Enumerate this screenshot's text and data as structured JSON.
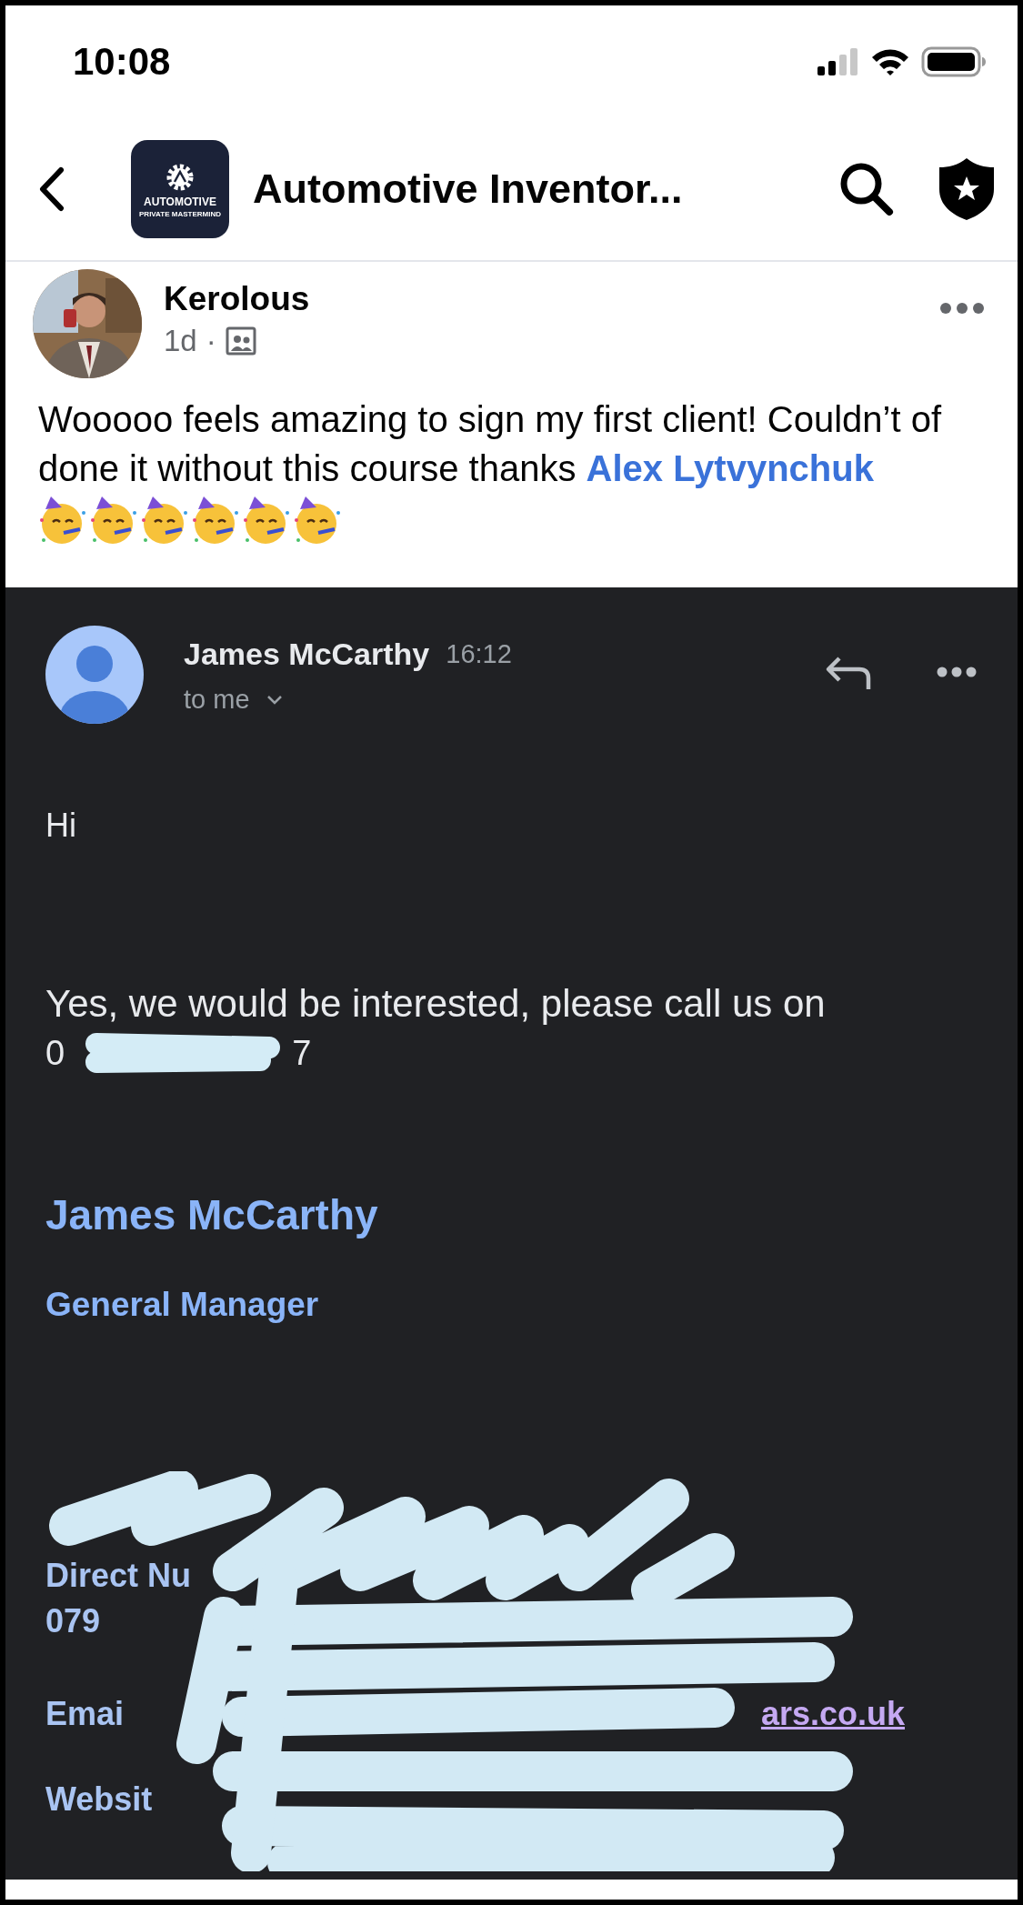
{
  "status_bar": {
    "time": "10:08"
  },
  "header": {
    "title": "Automotive Inventor...",
    "logo": {
      "title": "AUTOMOTIVE",
      "subtitle": "PRIVATE MASTERMIND"
    }
  },
  "post": {
    "author": "Kerolous",
    "age": "1d",
    "separator": "·",
    "text": "Wooooo feels amazing to sign my first client! Couldn’t of done it without this course thanks ",
    "mention": "Alex Lytvynchuk"
  },
  "email": {
    "sender": "James McCarthy",
    "time": "16:12",
    "recipient": "to me",
    "greeting": "Hi",
    "body": "Yes, we would be interested, please call us on",
    "phone_fragments": [
      "0",
      "7"
    ],
    "signature_name": "James McCarthy",
    "signature_title": "General Manager",
    "visible_fragments": {
      "direct_label": "Direct Nu",
      "direct_number": "079",
      "email_label": "Emai",
      "email_value": "ars.co.uk",
      "website_label": "Websit"
    }
  }
}
